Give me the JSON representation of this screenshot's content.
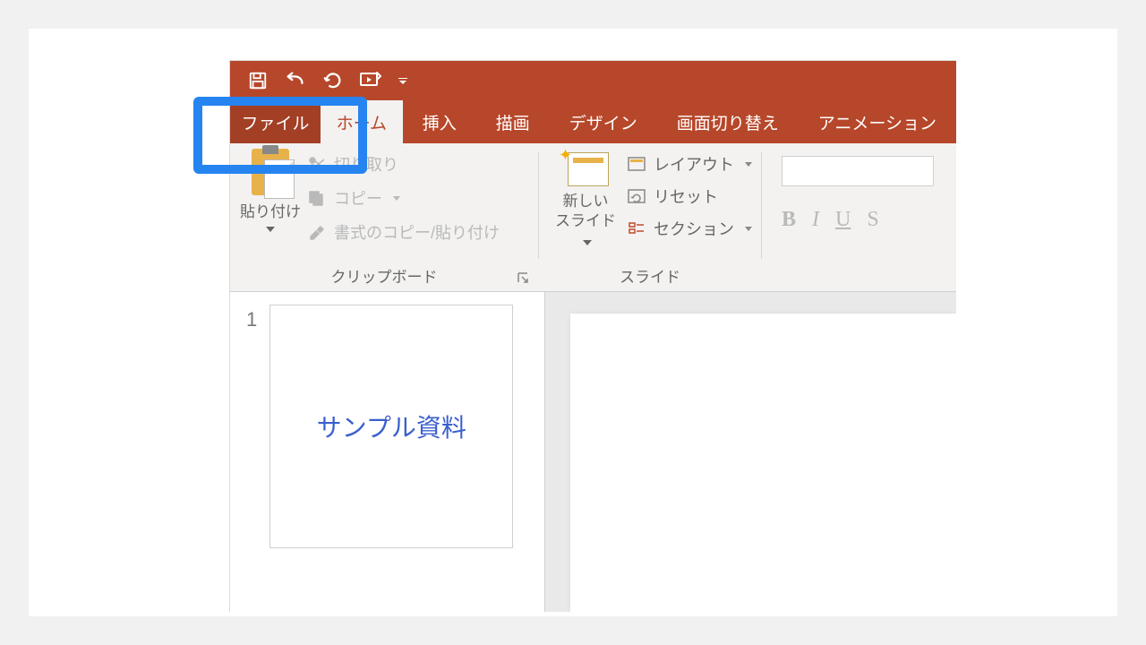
{
  "tabs": {
    "file": "ファイル",
    "home": "ホーム",
    "insert": "挿入",
    "draw": "描画",
    "design": "デザイン",
    "transitions": "画面切り替え",
    "animations": "アニメーション"
  },
  "clipboard": {
    "paste": "貼り付け",
    "cut": "切り取り",
    "copy": "コピー",
    "format_painter": "書式のコピー/貼り付け",
    "group_label": "クリップボード"
  },
  "slides": {
    "new_slide_l1": "新しい",
    "new_slide_l2": "スライド",
    "layout": "レイアウト",
    "reset": "リセット",
    "section": "セクション",
    "group_label": "スライド"
  },
  "font": {
    "b": "B",
    "i": "I",
    "u": "U",
    "s": "S"
  },
  "thumb": {
    "num": "1",
    "title": "サンプル資料"
  }
}
